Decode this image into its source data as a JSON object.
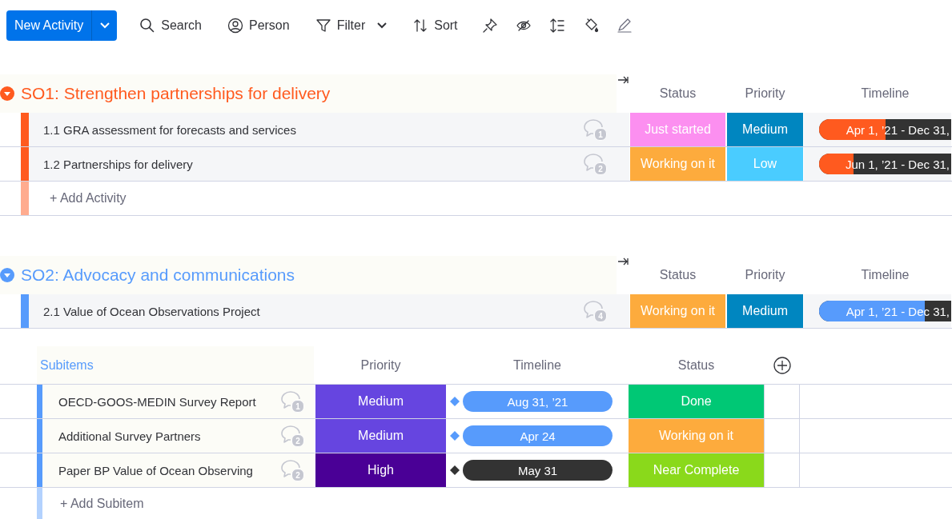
{
  "toolbar": {
    "primary": {
      "label": "New Activity"
    },
    "items": [
      {
        "kind": "search",
        "label": "Search"
      },
      {
        "kind": "person",
        "label": "Person"
      },
      {
        "kind": "filter",
        "label": "Filter",
        "dropdown": true
      },
      {
        "kind": "sort",
        "label": "Sort"
      },
      {
        "kind": "pin"
      },
      {
        "kind": "hide"
      },
      {
        "kind": "height"
      },
      {
        "kind": "paint"
      },
      {
        "kind": "edit"
      }
    ]
  },
  "groups": [
    {
      "title": "SO1: Strengthen partnerships for delivery",
      "color": "#ff5a1f",
      "expanded": true,
      "columns": [
        "Status",
        "Priority",
        "Timeline"
      ],
      "items": [
        {
          "name": "1.1 GRA assessment for forecasts and services",
          "comments": "1",
          "status": {
            "label": "Just started",
            "color": "#fc8ff0"
          },
          "priority": {
            "label": "Medium",
            "color": "#0086c0"
          },
          "timeline": {
            "label": "Apr 1, ’21 - Dec 31,",
            "level": 0.5
          }
        },
        {
          "name": "1.2 Partnerships for delivery",
          "comments": "2",
          "status": {
            "label": "Working on it",
            "color": "#fdab3d"
          },
          "priority": {
            "label": "Low",
            "color": "#4accff"
          },
          "timeline": {
            "label": "Jun 1, ’21 - Dec 31,",
            "level": 0.26
          }
        }
      ],
      "add_label": "+ Add Activity"
    },
    {
      "title": "SO2: Advocacy and communications",
      "color": "#579bfc",
      "expanded": true,
      "columns": [
        "Status",
        "Priority",
        "Timeline"
      ],
      "items": [
        {
          "name": "2.1 Value of Ocean Observations Project",
          "comments": "4",
          "status": {
            "label": "Working on it",
            "color": "#fdab3d"
          },
          "priority": {
            "label": "Medium",
            "color": "#0086c0"
          },
          "timeline": {
            "label": "Apr 1, ’21 - Dec 31,",
            "level": 0.8
          }
        }
      ],
      "subitems": {
        "header": "Subitems",
        "columns": [
          "Priority",
          "Timeline",
          "Status"
        ],
        "items": [
          {
            "name": "OECD-GOOS-MEDIN Survey Report",
            "comments": "1",
            "priority": {
              "label": "Medium",
              "color": "#6645e0"
            },
            "timeline": {
              "label": "Aug 31, ’21",
              "color": "#579bfc"
            },
            "status": {
              "label": "Done",
              "color": "#00c875"
            }
          },
          {
            "name": "Additional Survey Partners",
            "comments": "2",
            "priority": {
              "label": "Medium",
              "color": "#6645e0"
            },
            "timeline": {
              "label": "Apr 24",
              "color": "#579bfc"
            },
            "status": {
              "label": "Working on it",
              "color": "#fdab3d"
            }
          },
          {
            "name": "Paper BP Value of Ocean Observing",
            "comments": "2",
            "priority": {
              "label": "High",
              "color": "#4a0096"
            },
            "timeline": {
              "label": "May 31",
              "color": "#333333"
            },
            "status": {
              "label": "Near Complete",
              "color": "#8ad91b"
            }
          }
        ],
        "add_label": "+ Add Subitem"
      }
    }
  ]
}
